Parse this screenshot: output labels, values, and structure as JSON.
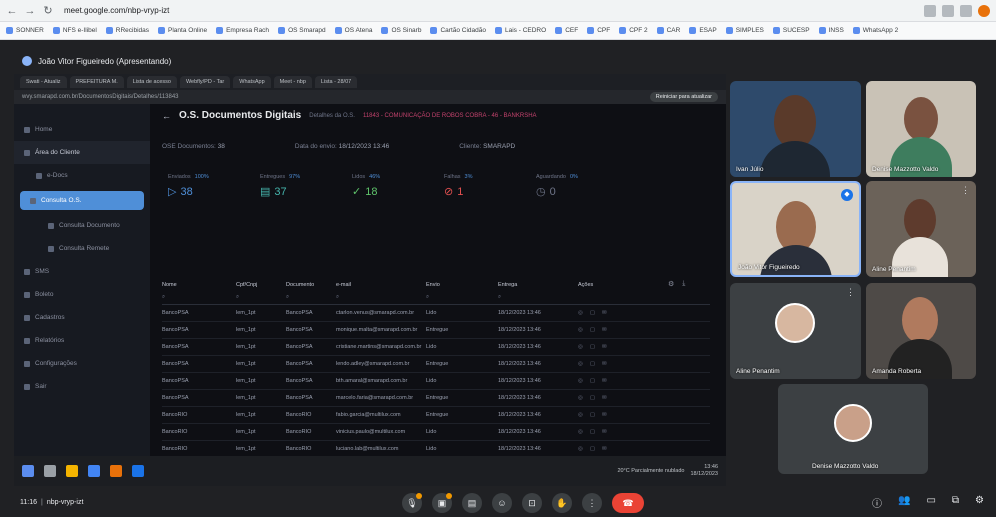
{
  "browser": {
    "url": "meet.google.com/nbp-vryp-izt",
    "bookmarks": [
      "SONNER",
      "NFS e-Ilibel",
      "RRecibidas",
      "Planta Online",
      "Empresa Rach",
      "OS Smarapd",
      "OS Atena",
      "OS Sinarb",
      "Cartão Cidadão",
      "Lais - CEDRO",
      "CEF",
      "CPF",
      "CPF 2",
      "CAR",
      "ESAP",
      "SIMPLES",
      "SUCESP",
      "INSS",
      "WhatsApp 2"
    ]
  },
  "meet": {
    "presenter_banner": "João Vitor Figueiredo (Apresentando)",
    "meeting_code": "nbp-vryp-izt",
    "time": "11:16",
    "sep": "|"
  },
  "shared": {
    "tabs": [
      "Swati - Atualiz",
      "PREFEITURA M.",
      "Lista de acesso",
      "Webfly/PD - Tar",
      "WhatsApp",
      "Meet - nbp",
      "Lista - 28/07"
    ],
    "url": "wvy.smarapd.com.br/DocumentosDigitais/Detalhes/113843",
    "pill": "Reiniciar para atualizar",
    "page_title": "O.S. Documentos Digitais",
    "back": "←",
    "crumb": "Detalhes da O.S.",
    "crumb2": "11843 - COMUNICAÇÃO DE ROBOS COBRA - 46 - BANKRSHA",
    "meta": [
      {
        "label": "OSE Documentos:",
        "value": "38"
      },
      {
        "label": "Data do envio:",
        "value": "18/12/2023 13:46"
      },
      {
        "label": "Cliente:",
        "value": "SMARAPD"
      }
    ],
    "cards": [
      {
        "label": "Enviados",
        "tag": "100%",
        "value": "38",
        "icon": "▷",
        "color": "c-blue"
      },
      {
        "label": "Entregues",
        "tag": "97%",
        "value": "37",
        "icon": "▤",
        "color": "c-teal"
      },
      {
        "label": "Lidos",
        "tag": "46%",
        "value": "18",
        "icon": "✓",
        "color": "c-green"
      },
      {
        "label": "Falhas",
        "tag": "3%",
        "value": "1",
        "icon": "⊘",
        "color": "c-red"
      },
      {
        "label": "Aguardando",
        "tag": "0%",
        "value": "0",
        "icon": "◷",
        "color": "c-gray"
      }
    ],
    "sidebar": [
      "Home",
      "Área do Cliente",
      "e-Docs",
      "Consulta O.S.",
      "Consulta Documento",
      "Consulta Remete",
      "SMS",
      "Boleto",
      "Cadastros",
      "Relatórios",
      "Configurações",
      "Sair"
    ],
    "table": {
      "headers": [
        "Nome",
        "Cpf/Cnpj",
        "Documento",
        "e-mail",
        "Envio",
        "Entrega",
        "Ações"
      ],
      "rows": [
        [
          "BancoPSA",
          "lem_1pt",
          "BancoPSA",
          "ctarlon.venus@smarapd.com.br",
          "Lido",
          "18/12/2023 13:46"
        ],
        [
          "BancoPSA",
          "lem_1pt",
          "BancoPSA",
          "monique.malta@smarapd.com.br",
          "Entregue",
          "18/12/2023 13:46"
        ],
        [
          "BancoPSA",
          "lem_1pt",
          "BancoPSA",
          "cristiane.martins@smarapd.com.br",
          "Lido",
          "18/12/2023 13:46"
        ],
        [
          "BancoPSA",
          "lem_1pt",
          "BancoPSA",
          "lendo.adley@smarapd.com.br",
          "Entregue",
          "18/12/2023 13:46"
        ],
        [
          "BancoPSA",
          "lem_1pt",
          "BancoPSA",
          "bth.amaral@smarapd.com.br",
          "Lido",
          "18/12/2023 13:46"
        ],
        [
          "BancoPSA",
          "lem_1pt",
          "BancoPSA",
          "marcelo.faria@smarapd.com.br",
          "Entregue",
          "18/12/2023 13:46"
        ],
        [
          "BancoRIO",
          "lem_1pt",
          "BancoRIO",
          "fabio.garcia@multilux.com",
          "Entregue",
          "18/12/2023 13:46"
        ],
        [
          "BancoRIO",
          "lem_1pt",
          "BancoRIO",
          "vinicius.paulo@multilux.com",
          "Lido",
          "18/12/2023 13:46"
        ],
        [
          "BancoRIO",
          "lem_1pt",
          "BancoRIO",
          "luciano.lab@multilux.com",
          "Lido",
          "18/12/2023 13:46"
        ]
      ]
    },
    "taskbar": {
      "weather": "20°C Parcialmente nublado",
      "time": "13:46",
      "date": "18/12/2023"
    }
  },
  "participants": [
    {
      "name": "Ivan Júlio"
    },
    {
      "name": "Denise Mazzotto Valdo"
    },
    {
      "name": "João Vitor Figueiredo"
    },
    {
      "name": "Aline Penantim"
    },
    {
      "name": "Aline Penantim"
    },
    {
      "name": "Amanda Roberta"
    },
    {
      "name": "Denise Mazzotto Valdo"
    }
  ],
  "colors": {
    "accent": "#4f8fd8",
    "end_call": "#ea4335",
    "meet_bg": "#202124"
  }
}
